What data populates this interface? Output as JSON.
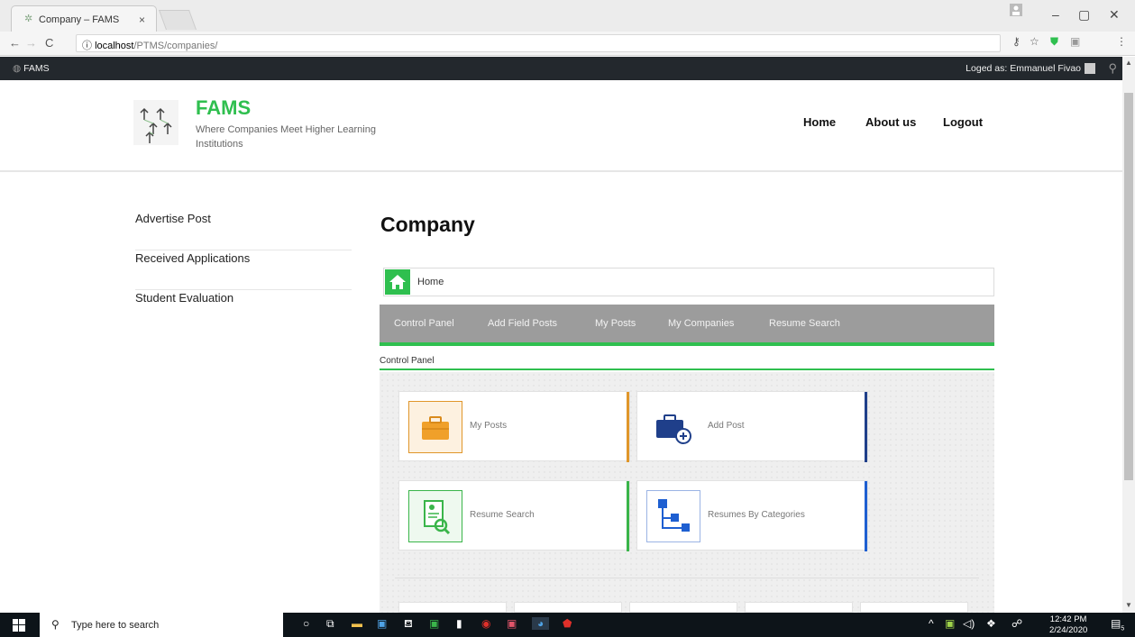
{
  "browser": {
    "tab_title": "Company – FAMS",
    "tab_close": "×",
    "nav_back": "←",
    "nav_forward": "→",
    "nav_reload": "C",
    "url_host": "localhost",
    "url_path": "/PTMS/companies/",
    "minimize": "–",
    "restore": "▢",
    "close": "✕"
  },
  "adminbar": {
    "site_name": "FAMS",
    "user_text": "Loged as: Emmanuel Fivao"
  },
  "header": {
    "brand": "FAMS",
    "tagline": "Where Companies Meet Higher Learning Institutions",
    "nav": [
      "Home",
      "About us",
      "Logout"
    ]
  },
  "sidebar": {
    "items": [
      "Advertise Post",
      "Received Applications",
      "Student Evaluation"
    ]
  },
  "main": {
    "title": "Company",
    "breadcrumb": "Home",
    "menu": [
      "Control Panel",
      "Add Field Posts",
      "My Posts",
      "My Companies",
      "Resume Search"
    ],
    "section_label": "Control Panel",
    "cards": [
      {
        "label": "My Posts",
        "icon": "briefcase-icon",
        "color": "#e0962a"
      },
      {
        "label": "Add Post",
        "icon": "briefcase-add-icon",
        "color": "#1f3f8a"
      },
      {
        "label": "Resume Search",
        "icon": "resume-search-icon",
        "color": "#3ab54a"
      },
      {
        "label": "Resumes By Categories",
        "icon": "category-tree-icon",
        "color": "#1e5fd1"
      }
    ]
  },
  "taskbar": {
    "search_placeholder": "Type here to search",
    "time": "12:42 PM",
    "date": "2/24/2020",
    "notif_count": "5"
  },
  "colors": {
    "accent_green": "#2fbf4f",
    "admin_bar": "#23282d",
    "menu_grey": "#9c9c9c"
  }
}
